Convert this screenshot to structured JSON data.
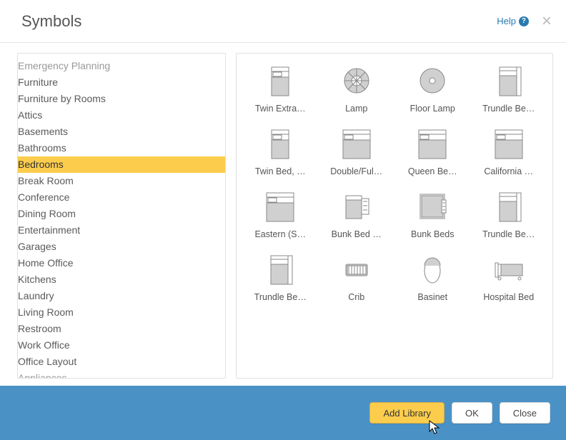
{
  "header": {
    "title": "Symbols",
    "help_label": "Help"
  },
  "tree": {
    "top_cut": "Emergency Planning",
    "furniture": "Furniture",
    "by_rooms": "Furniture by Rooms",
    "rooms": [
      "Attics",
      "Basements",
      "Bathrooms",
      "Bedrooms",
      "Break Room",
      "Conference",
      "Dining Room",
      "Entertainment",
      "Garages",
      "Home Office",
      "Kitchens",
      "Laundry",
      "Living Room",
      "Restroom",
      "Work Office"
    ],
    "selected_index": 3,
    "office_layout": "Office Layout",
    "bottom_cut": "Appliances"
  },
  "symbols": [
    {
      "label": "Twin Extra…",
      "kind": "bed-narrow"
    },
    {
      "label": "Lamp",
      "kind": "lamp"
    },
    {
      "label": "Floor Lamp",
      "kind": "floor-lamp"
    },
    {
      "label": "Trundle Be…",
      "kind": "trundle"
    },
    {
      "label": "Twin Bed, …",
      "kind": "bed-narrow"
    },
    {
      "label": "Double/Ful…",
      "kind": "bed-wide"
    },
    {
      "label": "Queen Be…",
      "kind": "bed-wide"
    },
    {
      "label": "California …",
      "kind": "bed-wide"
    },
    {
      "label": "Eastern (S…",
      "kind": "bed-wide"
    },
    {
      "label": "Bunk Bed …",
      "kind": "bunk-single"
    },
    {
      "label": "Bunk Beds",
      "kind": "bunk-double"
    },
    {
      "label": "Trundle Be…",
      "kind": "trundle"
    },
    {
      "label": "Trundle Be…",
      "kind": "trundle"
    },
    {
      "label": "Crib",
      "kind": "crib"
    },
    {
      "label": "Basinet",
      "kind": "basinet"
    },
    {
      "label": "Hospital Bed",
      "kind": "hospital"
    }
  ],
  "footer": {
    "add_library": "Add Library",
    "ok": "OK",
    "close": "Close"
  }
}
